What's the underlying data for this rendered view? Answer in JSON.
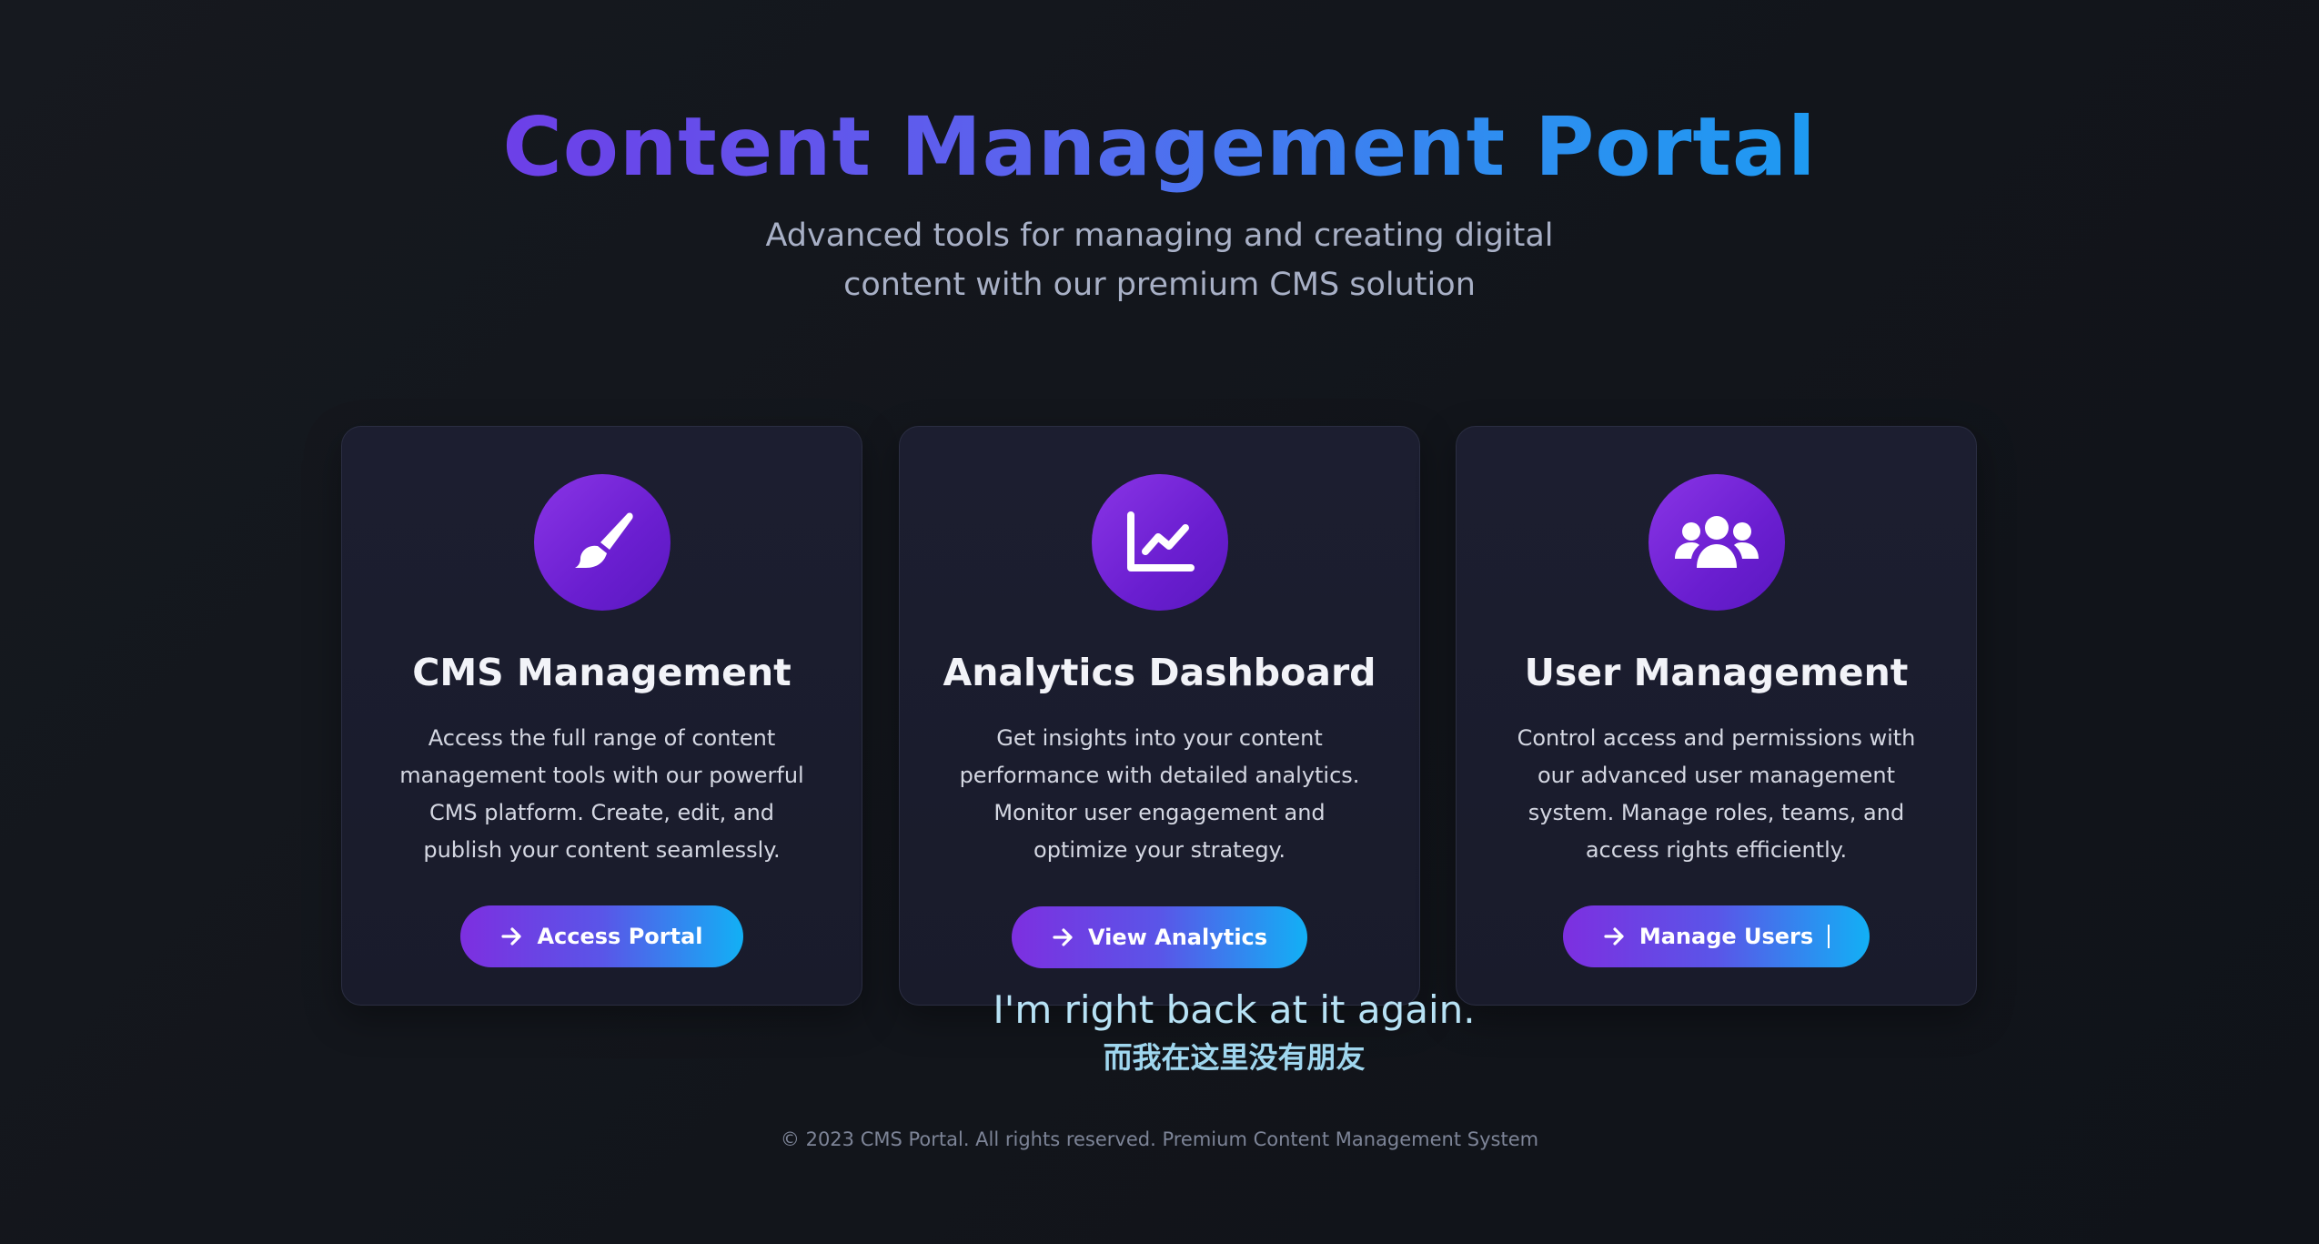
{
  "header": {
    "title": "Content Management Portal",
    "subtitle": "Advanced tools for managing and creating digital content with our premium CMS solution"
  },
  "cards": [
    {
      "icon": "paintbrush-icon",
      "title": "CMS Management",
      "description": "Access the full range of content management tools with our powerful CMS platform. Create, edit, and publish your content seamlessly.",
      "button_label": "Access Portal"
    },
    {
      "icon": "chart-line-icon",
      "title": "Analytics Dashboard",
      "description": "Get insights into your content performance with detailed analytics. Monitor user engagement and optimize your strategy.",
      "button_label": "View Analytics"
    },
    {
      "icon": "users-icon",
      "title": "User Management",
      "description": "Control access and permissions with our advanced user management system. Manage roles, teams, and access rights efficiently.",
      "button_label": "Manage Users"
    }
  ],
  "overlay": {
    "line_en": "I'm right back at it again.",
    "line_zh": "而我在这里没有朋友"
  },
  "footer": {
    "text": "© 2023 CMS Portal. All rights reserved. Premium Content Management System"
  },
  "colors": {
    "accent_start": "#7d2fe0",
    "accent_end": "#12b0f5",
    "icon_bg": "#6a1ed0",
    "card_bg": "#1c1e30",
    "page_bg": "#14171d"
  }
}
